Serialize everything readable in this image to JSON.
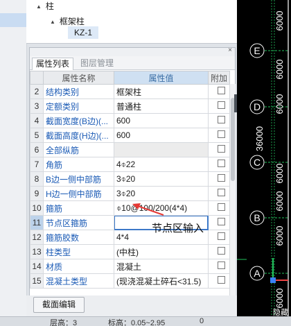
{
  "tree": {
    "items": [
      "柱",
      "框架柱",
      "KZ-1"
    ]
  },
  "panel": {
    "close_symbol": "×",
    "tabs": [
      {
        "label": "属性列表",
        "active": true
      },
      {
        "label": "图层管理",
        "active": false
      }
    ],
    "columns": [
      "属性名称",
      "属性值",
      "附加"
    ],
    "rows": [
      {
        "num": "2",
        "name": "结构类别",
        "value": "框架柱"
      },
      {
        "num": "3",
        "name": "定额类别",
        "value": "普通柱"
      },
      {
        "num": "4",
        "name": "截面宽度(B边)(...",
        "value": "600"
      },
      {
        "num": "5",
        "name": "截面高度(H边)(...",
        "value": "600"
      },
      {
        "num": "6",
        "name": "全部纵筋",
        "value": ""
      },
      {
        "num": "7",
        "name": "角筋",
        "value": "4⌽22"
      },
      {
        "num": "8",
        "name": "B边一侧中部筋",
        "value": "3⌽20"
      },
      {
        "num": "9",
        "name": "H边一侧中部筋",
        "value": "3⌽20"
      },
      {
        "num": "10",
        "name": "箍筋",
        "value": "⌽10@100/200(4*4)"
      },
      {
        "num": "11",
        "name": "节点区箍筋",
        "value": ""
      },
      {
        "num": "12",
        "name": "箍筋胶数",
        "value": "4*4"
      },
      {
        "num": "13",
        "name": "柱类型",
        "value": "(中柱)"
      },
      {
        "num": "14",
        "name": "材质",
        "value": "混凝土"
      },
      {
        "num": "15",
        "name": "混凝土类型",
        "value": "(现浇混凝土碎石<31.5)"
      }
    ]
  },
  "annotation": {
    "text": "节点区输入",
    "arrow_color": "#e53935"
  },
  "buttons": {
    "section_edit": "截面编辑"
  },
  "status": {
    "floor": "层高：3",
    "elevation": "标高：0.05~2.95",
    "count": "0"
  },
  "cad": {
    "axis_labels": [
      "E",
      "D",
      "C",
      "B",
      "A"
    ],
    "dimensions": [
      "6000",
      "6000",
      "6000",
      "36000",
      "6000",
      "6000",
      "6000",
      "6000"
    ],
    "hint": "隐藏",
    "colors": {
      "bg": "#000000",
      "line": "#22c55e",
      "text": "#ffffff",
      "axis_x": "#3b82f6",
      "axis_y": "#22c55e",
      "axis_z": "#ef4444"
    }
  }
}
